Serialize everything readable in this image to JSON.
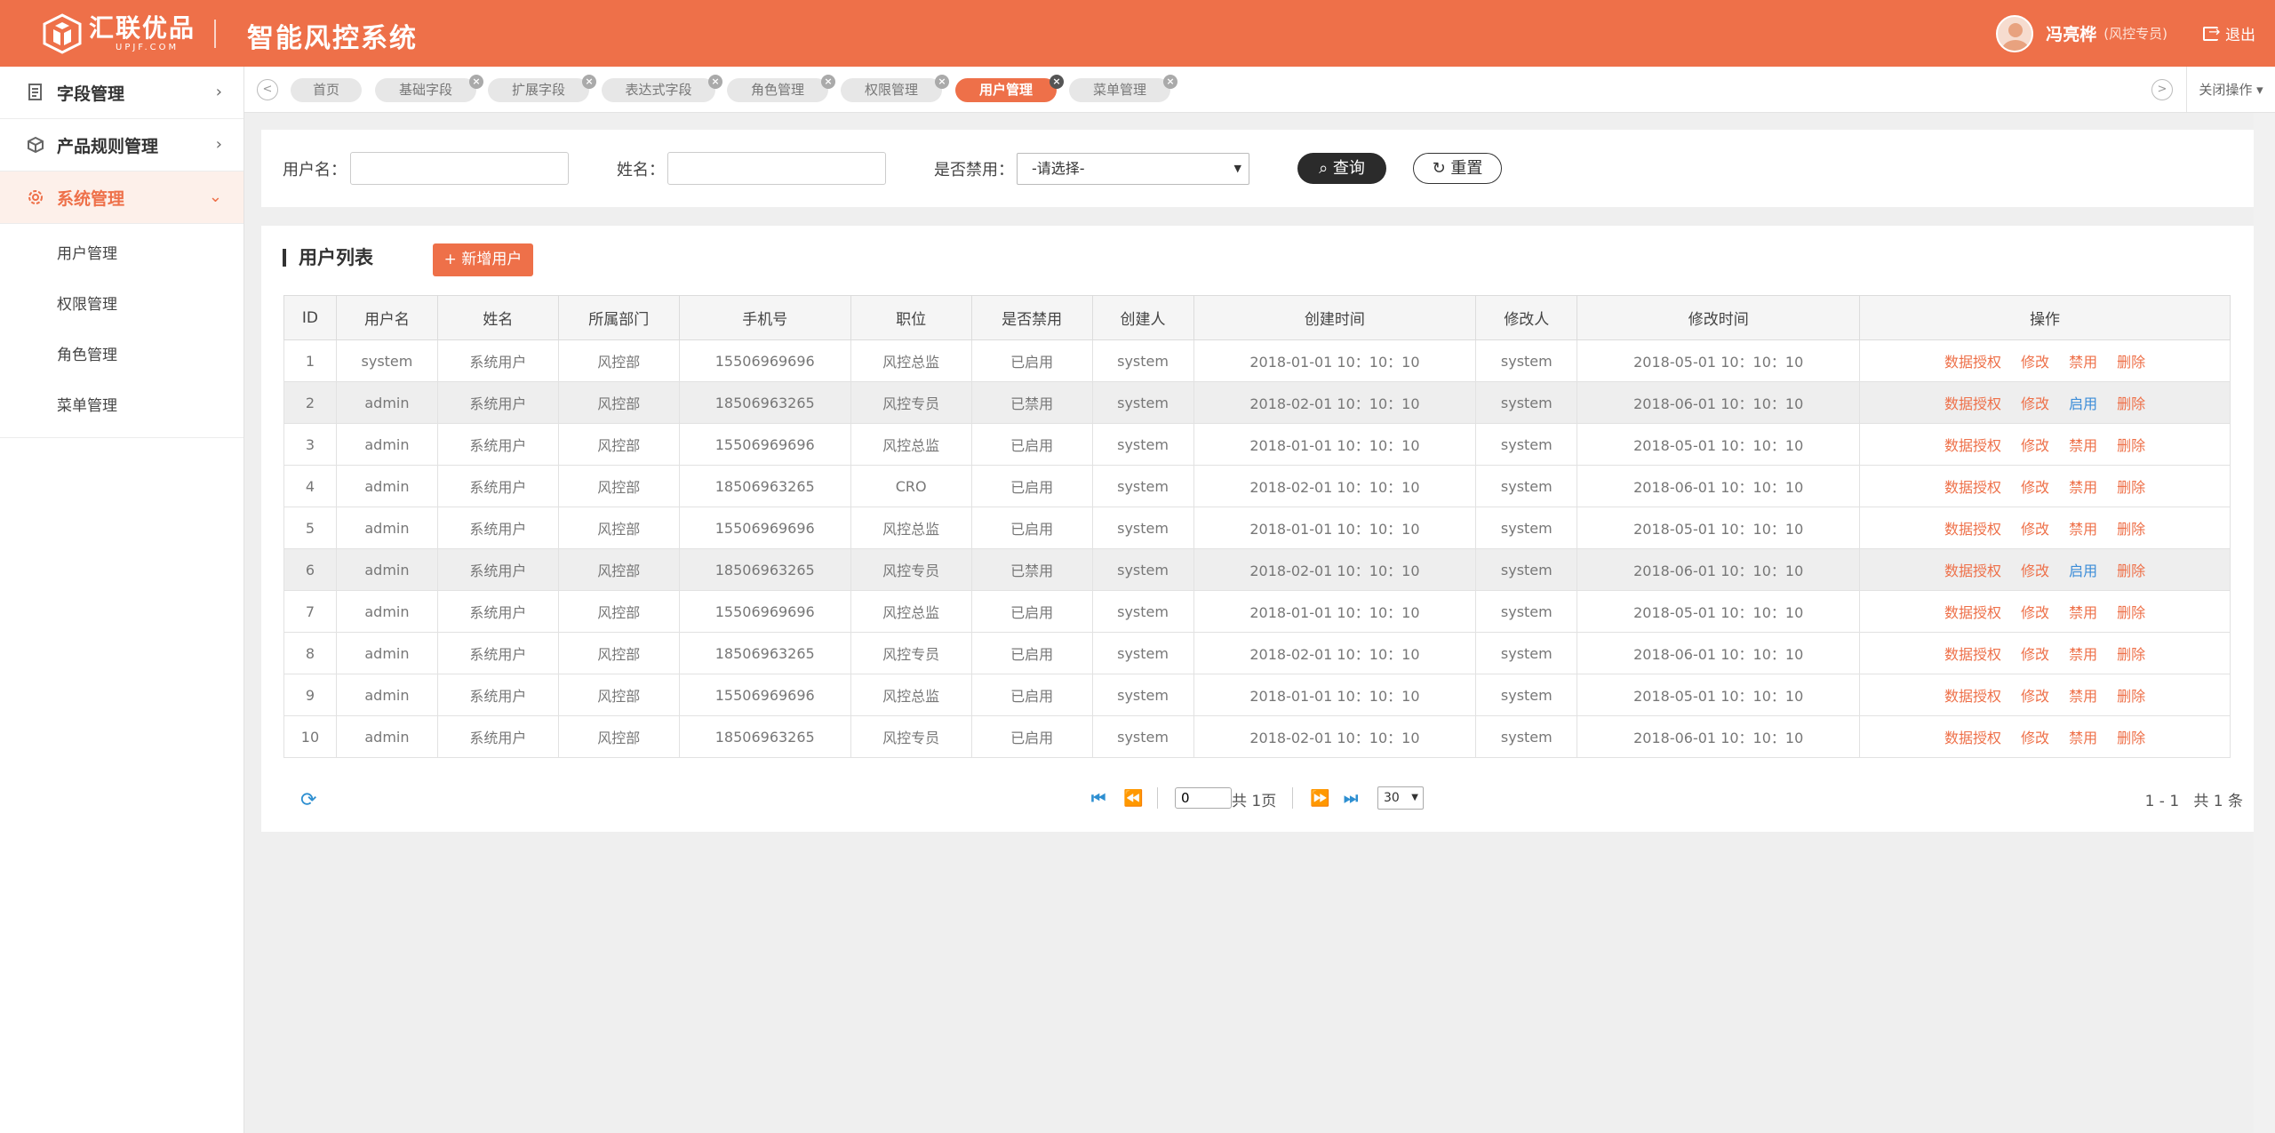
{
  "header": {
    "logo_name": "汇联优品",
    "logo_sub": "UPJF.COM",
    "system_title": "智能风控系统",
    "user_name": "冯亮桦",
    "user_role": "(风控专员)",
    "logout_label": "退出"
  },
  "sidebar": {
    "menus": [
      {
        "label": "字段管理",
        "icon": "document-icon"
      },
      {
        "label": "产品规则管理",
        "icon": "box-icon"
      },
      {
        "label": "系统管理",
        "icon": "gear-icon"
      }
    ],
    "submenu": [
      "用户管理",
      "权限管理",
      "角色管理",
      "菜单管理"
    ]
  },
  "tabs": {
    "items": [
      "首页",
      "基础字段",
      "扩展字段",
      "表达式字段",
      "角色管理",
      "权限管理",
      "用户管理",
      "菜单管理"
    ],
    "active": "用户管理",
    "close_ops_label": "关闭操作"
  },
  "search": {
    "username_label": "用户名：",
    "username_value": "",
    "realname_label": "姓名：",
    "realname_value": "",
    "disabled_label": "是否禁用：",
    "disabled_value": "-请选择-",
    "query_label": "查询",
    "reset_label": "重置"
  },
  "list": {
    "title": "用户列表",
    "add_label": "新增用户",
    "columns": [
      "ID",
      "用户名",
      "姓名",
      "所属部门",
      "手机号",
      "职位",
      "是否禁用",
      "创建人",
      "创建时间",
      "修改人",
      "修改时间",
      "操作"
    ],
    "rows": [
      {
        "id": "1",
        "username": "system",
        "name": "系统用户",
        "dept": "风控部",
        "phone": "15506969696",
        "position": "风控总监",
        "status": "已启用",
        "creator": "system",
        "created": "2018-01-01 10：10：10",
        "modifier": "system",
        "modified": "2018-05-01 10：10：10",
        "toggle": "禁用"
      },
      {
        "id": "2",
        "username": "admin",
        "name": "系统用户",
        "dept": "风控部",
        "phone": "18506963265",
        "position": "风控专员",
        "status": "已禁用",
        "creator": "system",
        "created": "2018-02-01 10：10：10",
        "modifier": "system",
        "modified": "2018-06-01 10：10：10",
        "toggle": "启用"
      },
      {
        "id": "3",
        "username": "admin",
        "name": "系统用户",
        "dept": "风控部",
        "phone": "15506969696",
        "position": "风控总监",
        "status": "已启用",
        "creator": "system",
        "created": "2018-01-01 10：10：10",
        "modifier": "system",
        "modified": "2018-05-01 10：10：10",
        "toggle": "禁用"
      },
      {
        "id": "4",
        "username": "admin",
        "name": "系统用户",
        "dept": "风控部",
        "phone": "18506963265",
        "position": "CRO",
        "status": "已启用",
        "creator": "system",
        "created": "2018-02-01 10：10：10",
        "modifier": "system",
        "modified": "2018-06-01 10：10：10",
        "toggle": "禁用"
      },
      {
        "id": "5",
        "username": "admin",
        "name": "系统用户",
        "dept": "风控部",
        "phone": "15506969696",
        "position": "风控总监",
        "status": "已启用",
        "creator": "system",
        "created": "2018-01-01 10：10：10",
        "modifier": "system",
        "modified": "2018-05-01 10：10：10",
        "toggle": "禁用"
      },
      {
        "id": "6",
        "username": "admin",
        "name": "系统用户",
        "dept": "风控部",
        "phone": "18506963265",
        "position": "风控专员",
        "status": "已禁用",
        "creator": "system",
        "created": "2018-02-01 10：10：10",
        "modifier": "system",
        "modified": "2018-06-01 10：10：10",
        "toggle": "启用"
      },
      {
        "id": "7",
        "username": "admin",
        "name": "系统用户",
        "dept": "风控部",
        "phone": "15506969696",
        "position": "风控总监",
        "status": "已启用",
        "creator": "system",
        "created": "2018-01-01 10：10：10",
        "modifier": "system",
        "modified": "2018-05-01 10：10：10",
        "toggle": "禁用"
      },
      {
        "id": "8",
        "username": "admin",
        "name": "系统用户",
        "dept": "风控部",
        "phone": "18506963265",
        "position": "风控专员",
        "status": "已启用",
        "creator": "system",
        "created": "2018-02-01 10：10：10",
        "modifier": "system",
        "modified": "2018-06-01 10：10：10",
        "toggle": "禁用"
      },
      {
        "id": "9",
        "username": "admin",
        "name": "系统用户",
        "dept": "风控部",
        "phone": "15506969696",
        "position": "风控总监",
        "status": "已启用",
        "creator": "system",
        "created": "2018-01-01 10：10：10",
        "modifier": "system",
        "modified": "2018-05-01 10：10：10",
        "toggle": "禁用"
      },
      {
        "id": "10",
        "username": "admin",
        "name": "系统用户",
        "dept": "风控部",
        "phone": "18506963265",
        "position": "风控专员",
        "status": "已启用",
        "creator": "system",
        "created": "2018-02-01 10：10：10",
        "modifier": "system",
        "modified": "2018-06-01 10：10：10",
        "toggle": "禁用"
      }
    ],
    "ops": {
      "grant": "数据授权",
      "edit": "修改",
      "delete": "删除"
    }
  },
  "pager": {
    "page_value": "0",
    "total_pages": "共 1页",
    "page_size": "30",
    "range": "1 - 1",
    "total": "共 1 条"
  },
  "colors": {
    "brand": "#ee7049",
    "enable_link": "#3c8dd8",
    "pager_icon": "#2d8fd1"
  }
}
